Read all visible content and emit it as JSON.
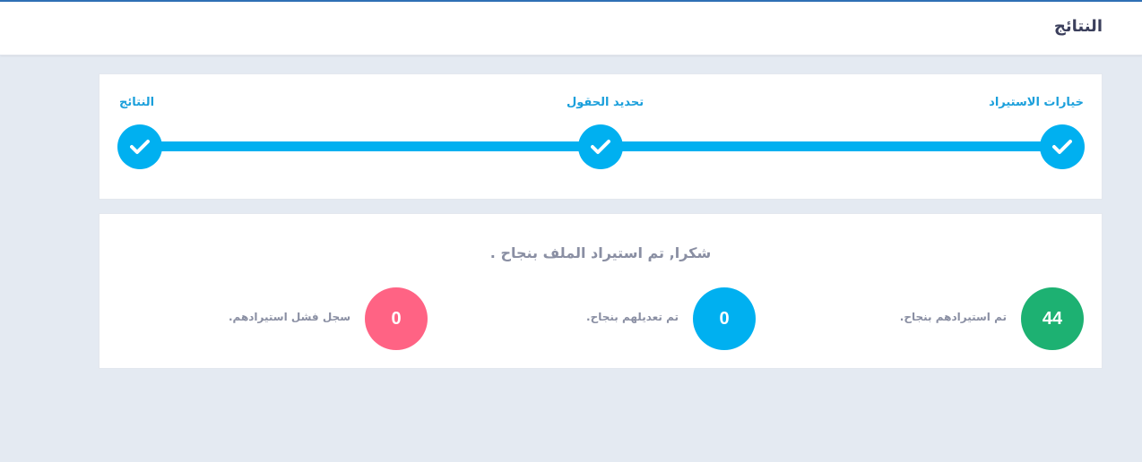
{
  "header": {
    "title": "النتائج"
  },
  "steps": [
    {
      "label": "خيارات الاستيراد",
      "icon": "check-icon",
      "completed": true
    },
    {
      "label": "تحديد الحقول",
      "icon": "check-icon",
      "completed": true
    },
    {
      "label": "النتائج",
      "icon": "check-icon",
      "completed": true
    }
  ],
  "results": {
    "message": "شكرا, تم استيراد الملف بنجاح .",
    "stats": [
      {
        "value": "44",
        "label": "تم استيرادهم بنجاح.",
        "color": "#1db172"
      },
      {
        "value": "0",
        "label": "تم تعديلهم بنجاح.",
        "color": "#00b0f0"
      },
      {
        "value": "0",
        "label": "سجل فشل استيرادهم.",
        "color": "#ff6384"
      }
    ]
  },
  "colors": {
    "accent": "#00b0f0",
    "background": "#e4eaf2"
  }
}
